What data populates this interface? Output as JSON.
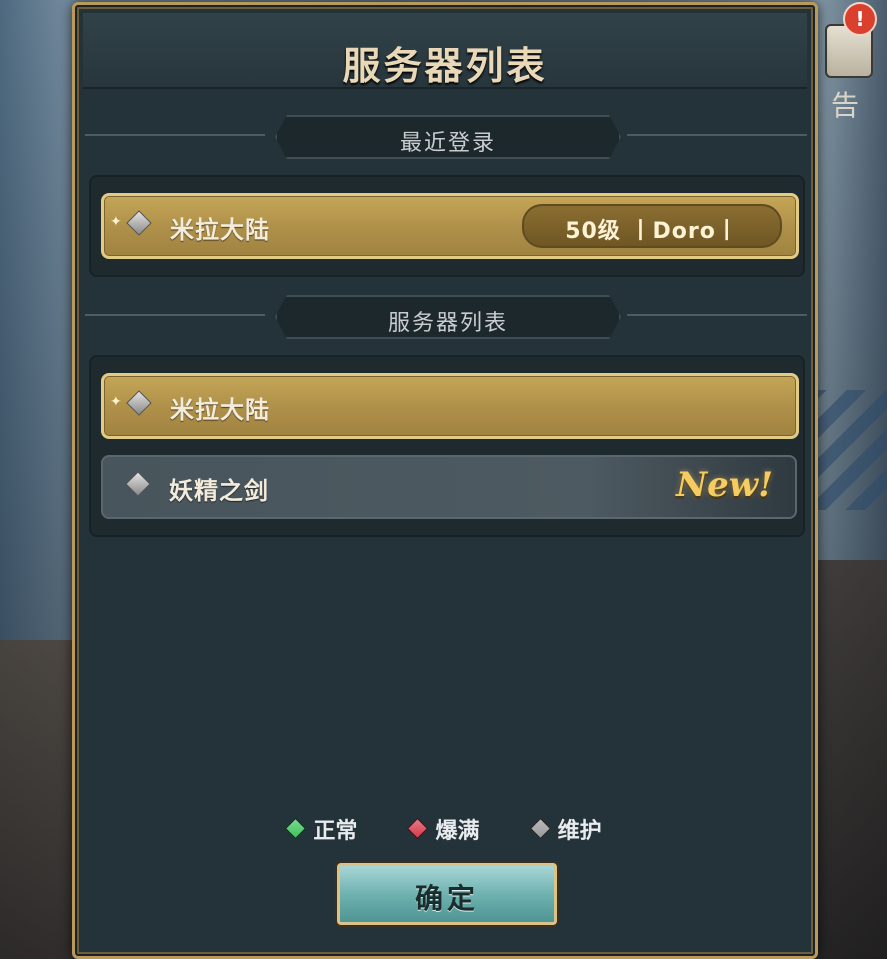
{
  "dialog": {
    "title": "服务器列表",
    "recent_section_label": "最近登录",
    "list_section_label": "服务器列表",
    "confirm_label": "确定"
  },
  "side_notice": {
    "label": "告",
    "alert": "!"
  },
  "recent_servers": [
    {
      "name": "米拉大陆",
      "status": "maintenance",
      "detail": "50级 丨Doro丨"
    }
  ],
  "servers": [
    {
      "name": "米拉大陆",
      "status": "maintenance",
      "selected": true,
      "badge": ""
    },
    {
      "name": "妖精之剑",
      "status": "maintenance",
      "selected": false,
      "badge": "New!"
    }
  ],
  "legend": [
    {
      "label": "正常",
      "color": "#3cc35a"
    },
    {
      "label": "爆满",
      "color": "#d8384a"
    },
    {
      "label": "维护",
      "color": "#9a9a9a"
    }
  ]
}
